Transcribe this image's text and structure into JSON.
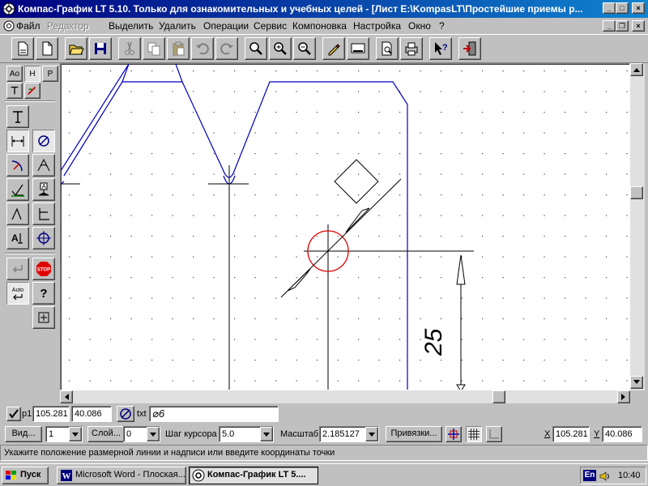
{
  "window": {
    "title": "Компас-График LT 5.10. Только для ознакомительных и учебных целей - [Лист E:\\KompasLT\\Простейшие приемы р...",
    "btn_minimize": "_",
    "btn_maximize": "□",
    "btn_close": "×"
  },
  "menu": {
    "items": [
      "Файл",
      "Редактор",
      "Выделить",
      "Удалить",
      "Операции",
      "Сервис",
      "Компоновка",
      "Настройка",
      "Окно",
      "?"
    ],
    "mdi_minimize": "_",
    "mdi_restore": "❐",
    "mdi_close": "×"
  },
  "left_panel": {
    "tabs": [
      "Ao",
      "Н",
      "P"
    ],
    "stop_label": "STOP",
    "auto_label": "Auto",
    "help_label": "?"
  },
  "drawing": {
    "dimension_text": "25",
    "colors": {
      "blue_lines": "#0000c0",
      "circle": "#e00000",
      "black": "#000000"
    }
  },
  "params": {
    "p1_label": "p1",
    "p1_x": "105.281",
    "p1_y": "40.086",
    "txt_label": "txt",
    "txt_value": "⌀6"
  },
  "status": {
    "view_button": "Вид...",
    "view_value": "1",
    "layer_button": "Слой...",
    "layer_value": "0",
    "cursor_step_label": "Шаг курсора",
    "cursor_step_value": "5.0",
    "scale_label": "Масштаб",
    "scale_value": "2.185127",
    "snaps_button": "Привязки...",
    "x_label": "X",
    "x_value": "105.281",
    "y_label": "Y",
    "y_value": "40.086",
    "hint": "Укажите положение размерной линии и надписи или введите координаты точки"
  },
  "taskbar": {
    "start": "Пуск",
    "tasks": [
      "Microsoft Word - Плоская...",
      "Компас-График LT 5...."
    ],
    "lang": "En",
    "clock": "10:40"
  }
}
